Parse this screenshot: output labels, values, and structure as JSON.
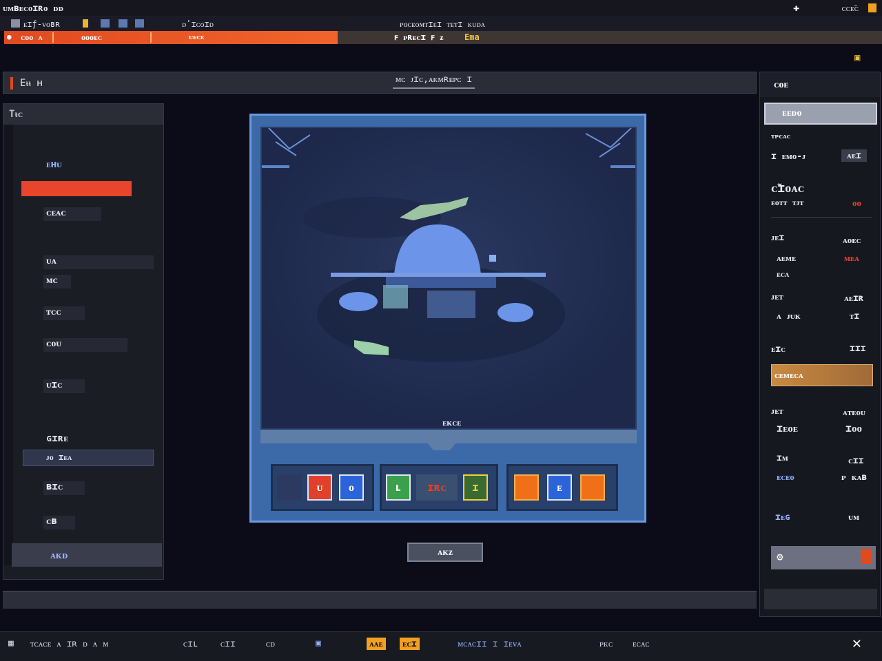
{
  "titlebar": {
    "title": "ᴜᴍʙᴇᴄᴏɪʀᴏ ᴅᴅ",
    "right_text": "ᴄᴄᴇ̃ᴄ"
  },
  "menu": {
    "item_file": "ᴇɪƒ-ᴠᴏʙʀ",
    "item_settings": "ᴅʹɪᴄᴏɪᴅ",
    "item_center": "ᴘᴏᴄᴇᴏᴍᴛɪᴇɪ ᴛᴇᴛɪ ᴋᴜᴅᴀ"
  },
  "progress": {
    "value_percent": 38,
    "label_left": "ᴄᴏᴏ ᴀ",
    "label_count": "ᴏᴏᴏᴇᴄ",
    "label_sub": "ᴜᴇᴄᴇ",
    "label_right": "ꜰ ᴘʀᴇᴄɪ ꜰ ᴢ",
    "label_right_hl": "Ema"
  },
  "editor": {
    "header_label": "Eᵼᵼ ʜ",
    "header_center": "ᴍᴄ ᴊɪᴄ,ᴀᴋᴍʀᴇᴘᴄ ɪ"
  },
  "left_panel": {
    "title": "Tᵼᴄ",
    "items": [
      "ᴇʜᴜ",
      "ᴄᴇᴀᴄ",
      "ᴜᴀ",
      "ᴍᴄ",
      "ᴛᴄᴄ",
      "ᴄᴏᴜ",
      "ᴜɪᴄ",
      "ɢɪʀᴇ",
      "ᴊᴏ ɪᴇᴀ",
      "ʙɪᴄ",
      "ᴄʙ"
    ],
    "footer_label": "ᴀᴋᴅ"
  },
  "game": {
    "caption": "ᴇᴋᴄᴇ",
    "slots": [
      "ᴜ",
      "ᴏ",
      "ʟ",
      "ɪʀᴄ",
      "ɪ",
      "",
      "ᴇ",
      ""
    ],
    "action_label": "ᴀᴋᴢ"
  },
  "right_panel": {
    "title": "ᴄᴏᴇ",
    "search": "ᴇᴇᴅᴏ",
    "section1": "ᴛᴘᴄᴀᴄ",
    "row1_label": "ɪ ᴇᴍᴏ-ᴊ",
    "row1_value": "ᴀᴇɪ",
    "big_label": "ᴄ̃ɪᴏᴀᴄ",
    "row2_label": "ᴇᴏᴛᴛ ᴛᴊᴛ",
    "row2_value": "ᴏᴏ",
    "row3_label": "ᴊᴇɪ",
    "row3_value": "ᴀᴏᴇᴄ",
    "row4_label": "ᴀᴇᴍᴇ",
    "row4_value": "ᴍᴇᴀ",
    "row4_sub": "ᴇᴄᴀ",
    "row5_label": "ᴊᴇᴛ",
    "row5_value": "ᴀᴇɪʀ",
    "row6_label": "ᴀ ᴊᴜᴋ",
    "row6_value": "ᴛɪ",
    "row7_label": "ᴇɪᴄ",
    "row7_value": "ɪɪɪ",
    "button_label": "ᴄᴇᴍᴇᴄᴀ",
    "row8_label": "ᴊᴇᴛ",
    "row8_value": "ᴀᴛᴇᴏᴜ",
    "row9_label": "ɪᴇᴏᴇ",
    "row9_value": "ɪᴏᴏ",
    "row10_label": "ɪᴍ",
    "row10_value": "ᴄɪɪ",
    "row11_label": "ᴇᴄᴇᴏ",
    "row11_value": "ᴘ ᴋᴀʙ",
    "row12_label": "ɪᴇɢ",
    "row12_value": "ᴜᴍ"
  },
  "status": {
    "item1": "ᴛᴄᴀᴄᴇ ᴀ ɪʀ ᴅ ᴀ ᴍ",
    "item2": "ᴄɪʟ",
    "item3": "ᴄɪɪ",
    "item4": "ᴄᴅ",
    "warn1": "ᴀᴀᴇ",
    "warn2": "ᴇᴄɪ",
    "item5": "ᴍᴄᴀᴄɪɪ ɪ ɪᴇᴠᴀ",
    "item6": "ᴘᴋᴄ",
    "item7": "ᴇᴄᴀᴄ"
  },
  "colors": {
    "accent": "#e8452c",
    "viewport": "#3c6aa8",
    "warn": "#f2a020"
  }
}
